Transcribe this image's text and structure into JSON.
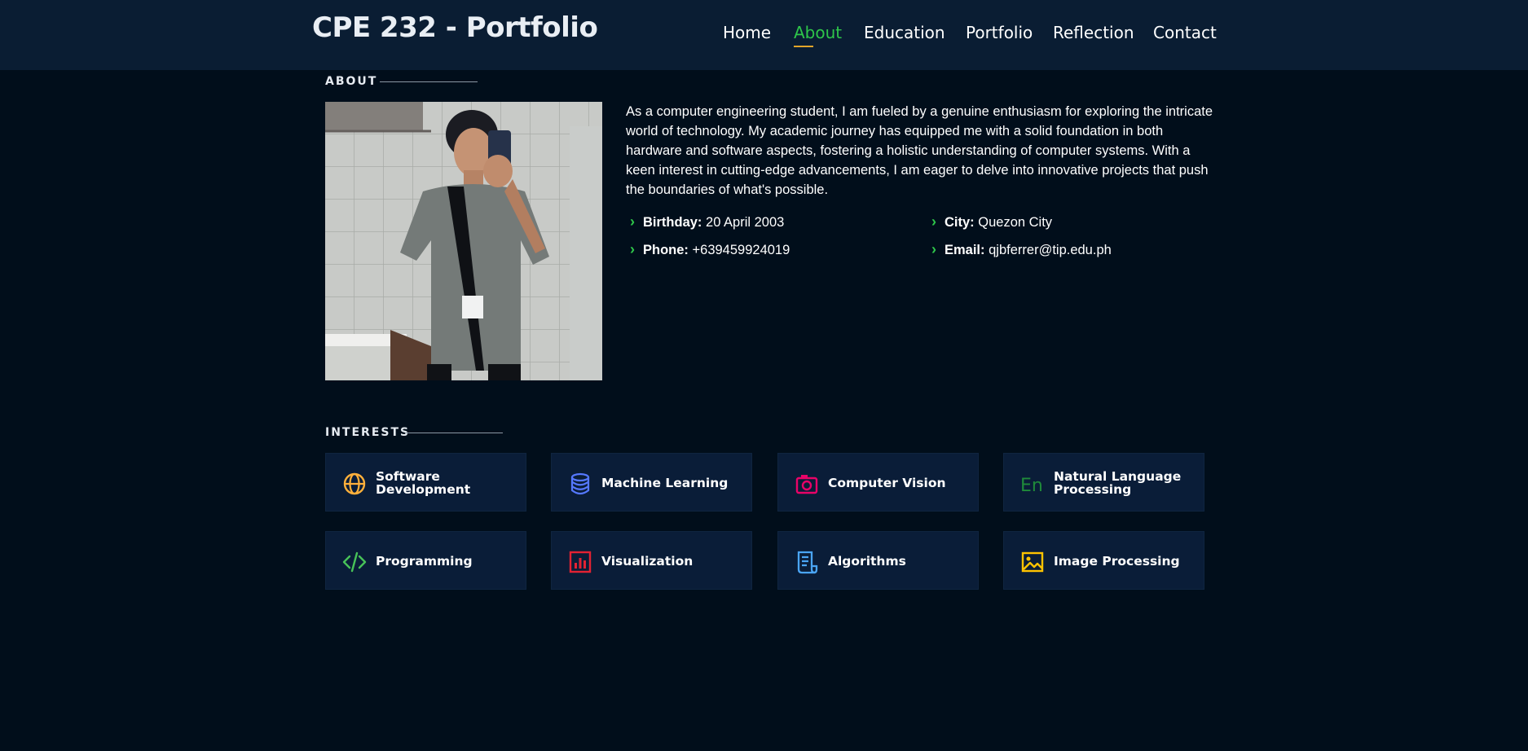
{
  "header": {
    "logo": "CPE 232 - Portfolio",
    "nav": [
      {
        "label": "Home",
        "active": false
      },
      {
        "label": "About",
        "active": true
      },
      {
        "label": "Education",
        "active": false
      },
      {
        "label": "Portfolio",
        "active": false
      },
      {
        "label": "Reflection",
        "active": false
      },
      {
        "label": "Contact",
        "active": false
      }
    ]
  },
  "about": {
    "title": "ABOUT",
    "description": "As a computer engineering student, I am fueled by a genuine enthusiasm for exploring the intricate world of technology. My academic journey has equipped me with a solid foundation in both hardware and software aspects, fostering a holistic understanding of computer systems. With a keen interest in cutting-edge advancements, I am eager to delve into innovative projects that push the boundaries of what's possible.",
    "info": [
      {
        "key": "Birthday:",
        "value": "20 April 2003"
      },
      {
        "key": "City:",
        "value": "Quezon City"
      },
      {
        "key": "Phone:",
        "value": "+639459924019"
      },
      {
        "key": "Email:",
        "value": "qjbferrer@tip.edu.ph"
      }
    ]
  },
  "interests": {
    "title": "INTERESTS",
    "items": [
      {
        "label": "Software Development",
        "icon": "globe-icon",
        "color": "#ffb03b"
      },
      {
        "label": "Machine Learning",
        "icon": "database-icon",
        "color": "#5578ff"
      },
      {
        "label": "Computer Vision",
        "icon": "camera-icon",
        "color": "#e80368"
      },
      {
        "label": "Natural Language Processing",
        "icon": "language-icon",
        "color": "#1f8a3a"
      },
      {
        "label": "Programming",
        "icon": "code-icon",
        "color": "#47c258"
      },
      {
        "label": "Visualization",
        "icon": "bar-chart-icon",
        "color": "#e32233"
      },
      {
        "label": "Algorithms",
        "icon": "document-icon",
        "color": "#4aa5f5"
      },
      {
        "label": "Image Processing",
        "icon": "image-icon",
        "color": "#ffc300"
      }
    ]
  },
  "colors": {
    "accent": "#2ec64a",
    "underline": "#e3a52a",
    "background": "#010e1b",
    "header": "#0a1d33",
    "card": "#0a1d38"
  }
}
